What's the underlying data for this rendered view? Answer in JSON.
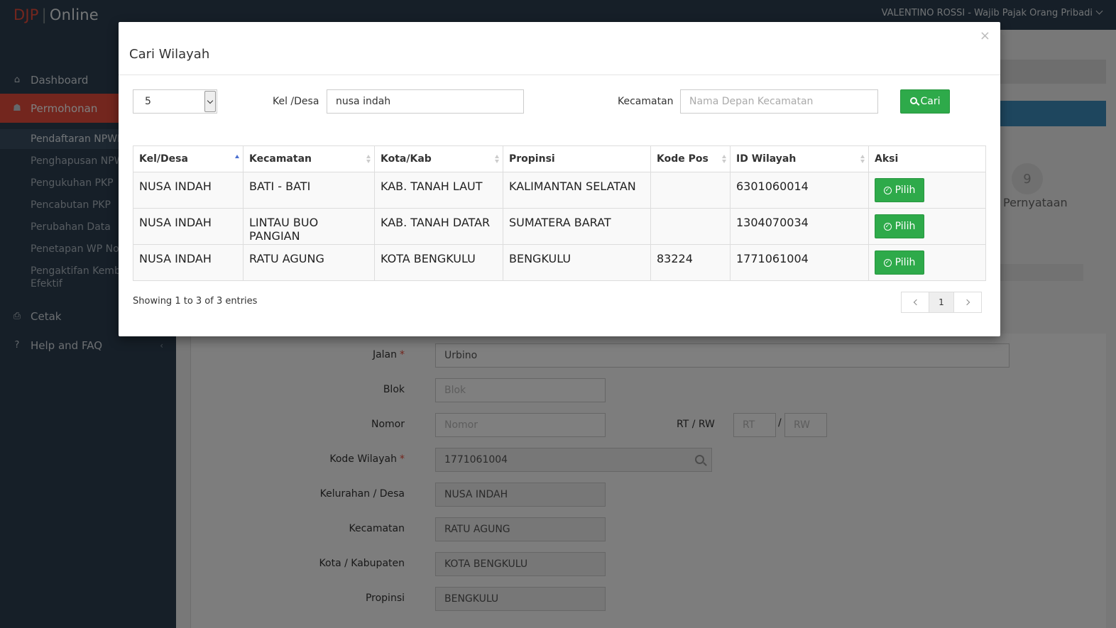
{
  "app": {
    "brand_left": "DJP",
    "brand_sep": "|",
    "brand_right": "Online",
    "user": "VALENTINO ROSSI - Wajib Pajak Orang Pribadi"
  },
  "sidebar": {
    "dashboard": "Dashboard",
    "permohonan": "Permohonan",
    "sub_items": [
      "Pendaftaran NPWP",
      "Penghapusan NPWP",
      "Pengukuhan PKP",
      "Pencabutan PKP",
      "Perubahan Data",
      "Penetapan WP Non",
      "Pengaktifan Kembali Efektif"
    ],
    "cetak": "Cetak",
    "help": "Help and FAQ"
  },
  "background": {
    "step_number": "9",
    "step_label": "Pernyataan",
    "form": {
      "jalan_label": "Jalan",
      "jalan_value": "Urbino",
      "blok_label": "Blok",
      "blok_placeholder": "Blok",
      "nomor_label": "Nomor",
      "nomor_placeholder": "Nomor",
      "rtrw_label": "RT / RW",
      "rt_placeholder": "RT",
      "rw_placeholder": "RW",
      "rtrw_sep": "/",
      "kode_wilayah_label": "Kode Wilayah",
      "kode_wilayah_value": "1771061004",
      "kelurahan_label": "Kelurahan / Desa",
      "kelurahan_value": "NUSA INDAH",
      "kecamatan_label": "Kecamatan",
      "kecamatan_value": "RATU AGUNG",
      "kota_label": "Kota / Kabupaten",
      "kota_value": "KOTA BENGKULU",
      "propinsi_label": "Propinsi",
      "propinsi_value": "BENGKULU",
      "required_mark": "*"
    }
  },
  "modal": {
    "title": "Cari Wilayah",
    "close": "×",
    "page_length": "5",
    "kel_label": "Kel /Desa",
    "kel_value": "nusa indah",
    "kec_label": "Kecamatan",
    "kec_placeholder": "Nama Depan Kecamatan",
    "search_button": "Cari",
    "columns": [
      "Kel/Desa",
      "Kecamatan",
      "Kota/Kab",
      "Propinsi",
      "Kode Pos",
      "ID Wilayah",
      "Aksi"
    ],
    "rows": [
      [
        "NUSA INDAH",
        "BATI - BATI",
        "KAB. TANAH LAUT",
        "KALIMANTAN SELATAN",
        "",
        "6301060014"
      ],
      [
        "NUSA INDAH",
        "LINTAU BUO PANGIAN",
        "KAB. TANAH DATAR",
        "SUMATERA BARAT",
        "",
        "1304070034"
      ],
      [
        "NUSA INDAH",
        "RATU AGUNG",
        "KOTA BENGKULU",
        "BENGKULU",
        "83224",
        "1771061004"
      ]
    ],
    "row_button": "Pilih",
    "info": "Showing 1 to 3 of 3 entries",
    "current_page": "1"
  },
  "colors": {
    "sidebar_bg": "#2c3e50",
    "active_nav": "#e74c3c",
    "button_green": "#2eaa4a",
    "sort_active": "#4a6fd0"
  }
}
